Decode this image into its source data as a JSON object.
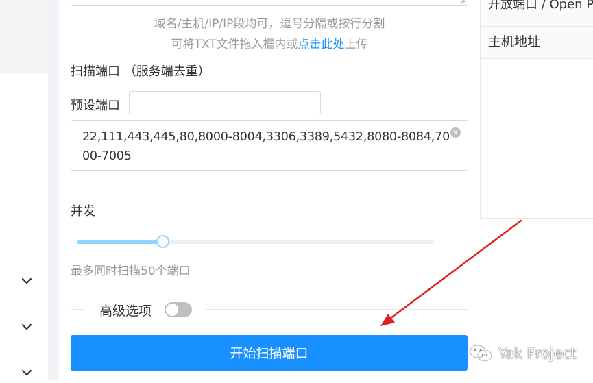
{
  "scan_form": {
    "target_hint": "域名/主机/IP/IP段均可，逗号分隔或按行分割",
    "upload_hint_prefix": "可将TXT文件拖入框内或",
    "upload_hint_link": "点击此处",
    "upload_hint_suffix": "上传",
    "scan_ports_label": "扫描端口 （服务端去重）",
    "preset_ports_label": "预设端口",
    "preset_ports_value": "",
    "ports_value": "22,111,443,445,80,8000-8004,3306,3389,5432,8080-8084,7000-7005",
    "concurrency_label": "并发",
    "concurrency_slider": {
      "value": 50,
      "fill_fraction": 0.24
    },
    "concurrency_hint": "最多同时扫描50个端口",
    "advanced_label": "高级选项",
    "advanced_enabled": false,
    "start_button_label": "开始扫描端口"
  },
  "results_panel": {
    "header": "开放端口 / Open P",
    "column_host": "主机地址"
  },
  "watermark": {
    "text": "Yak Project"
  },
  "colors": {
    "primary": "#1890ff",
    "slider": "#91d5ff",
    "annotation_arrow": "#e02020"
  }
}
